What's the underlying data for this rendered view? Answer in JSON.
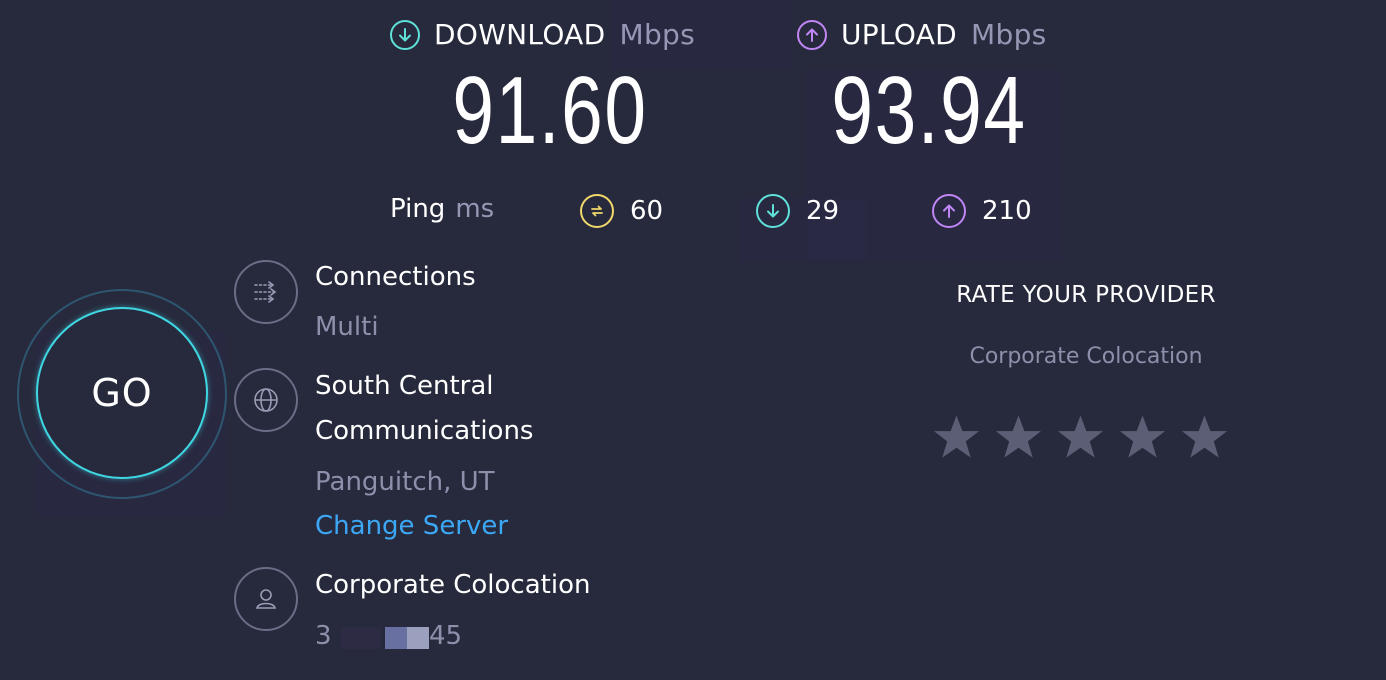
{
  "download": {
    "label": "DOWNLOAD",
    "unit": "Mbps",
    "value": "91.60",
    "icon": "arrow-down-circle-icon",
    "color": "#5fe0d8"
  },
  "upload": {
    "label": "UPLOAD",
    "unit": "Mbps",
    "value": "93.94",
    "icon": "arrow-up-circle-icon",
    "color": "#c186f5"
  },
  "ping": {
    "label": "Ping",
    "unit": "ms",
    "idle": {
      "value": "60",
      "icon": "ping-idle-icon",
      "color": "#f0d86a"
    },
    "download": {
      "value": "29",
      "icon": "arrow-down-circle-icon",
      "color": "#5fe0d8"
    },
    "upload": {
      "value": "210",
      "icon": "arrow-up-circle-icon",
      "color": "#c186f5"
    }
  },
  "go_button": {
    "label": "GO"
  },
  "connections": {
    "title": "Connections",
    "value": "Multi",
    "icon": "connections-icon"
  },
  "server": {
    "name_line1": "South Central",
    "name_line2": "Communications",
    "location": "Panguitch, UT",
    "change_link": "Change Server",
    "icon": "globe-icon"
  },
  "provider": {
    "name": "Corporate Colocation",
    "ip_prefix": "3",
    "ip_suffix": "45",
    "icon": "user-icon"
  },
  "rate": {
    "title": "RATE YOUR PROVIDER",
    "provider": "Corporate Colocation",
    "star_count": 5,
    "star_color": "#5c5e75"
  }
}
